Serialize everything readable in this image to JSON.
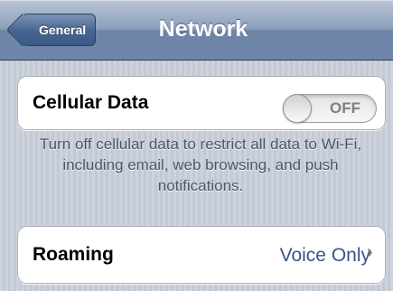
{
  "nav": {
    "back_label": "General",
    "title": "Network"
  },
  "cellular": {
    "label": "Cellular Data",
    "toggle_text": "OFF",
    "description": "Turn off cellular data to restrict all data to Wi-Fi, including email, web browsing, and push notifications."
  },
  "roaming": {
    "label": "Roaming",
    "value": "Voice Only",
    "chevron": "›"
  }
}
